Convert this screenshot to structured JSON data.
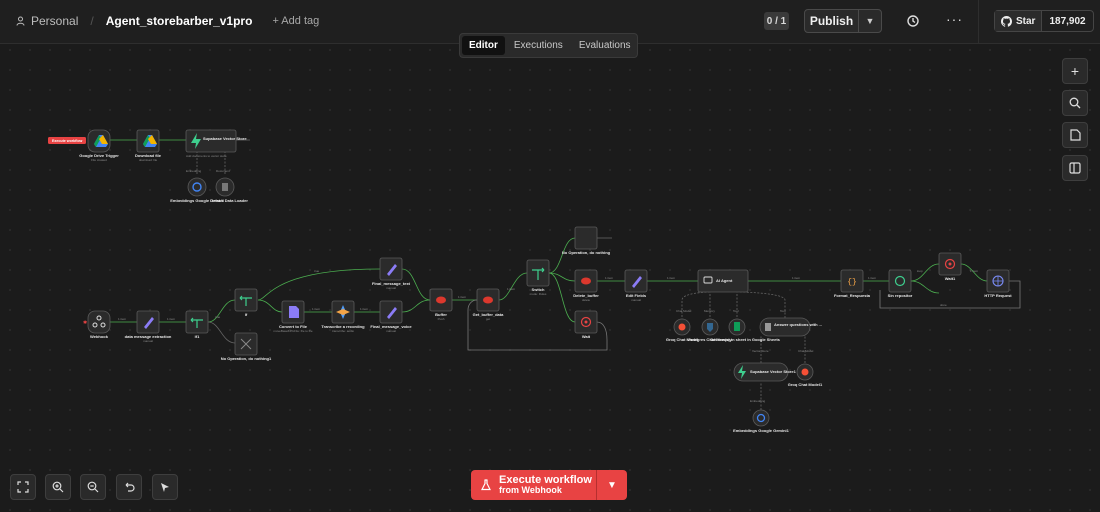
{
  "header": {
    "workspace": "Personal",
    "workflow_name": "Agent_storebarber_v1pro",
    "add_tag": "+ Add tag",
    "counter": "0 / 1",
    "publish": "Publish",
    "github_star": "Star",
    "github_count": "187,902"
  },
  "tabs": [
    {
      "label": "Editor",
      "active": true
    },
    {
      "label": "Executions",
      "active": false
    },
    {
      "label": "Evaluations",
      "active": false
    }
  ],
  "execute": {
    "line1": "Execute workflow",
    "line2": "from Webhook"
  },
  "colors": {
    "accent": "#e84343",
    "edge": "#4caf50",
    "node_bg": "#2b2b2b"
  },
  "right_tools": [
    "plus-icon",
    "search-icon",
    "sticky-note-icon",
    "panel-icon"
  ],
  "bottom_tools": [
    "fit-view-icon",
    "zoom-in-icon",
    "zoom-out-icon",
    "undo-icon",
    "tidy-up-icon"
  ],
  "trigger_badge": "Execute workflow",
  "nodes": {
    "gdrive_trigger": {
      "label": "Google Drive Trigger",
      "sub": "File created"
    },
    "download_file": {
      "label": "Download file",
      "sub": "download: file"
    },
    "supabase_store_top": {
      "label": "Supabase Vector Store",
      "sub": "Add documents to vector store"
    },
    "embeddings_top": {
      "label": "Embeddings Google Gemini"
    },
    "data_loader": {
      "label": "Default Data Loader"
    },
    "webhook": {
      "label": "Webhook"
    },
    "data_msg": {
      "label": "data message extraction",
      "sub": "manual"
    },
    "if1": {
      "label": "If1"
    },
    "if": {
      "label": "If"
    },
    "no_op1": {
      "label": "No Operation, do nothing1"
    },
    "convert_file": {
      "label": "Convert to File",
      "sub": "moveBase64ToFile: file to file"
    },
    "transcribe": {
      "label": "Transcribe a recording",
      "sub": "transcribe: audio"
    },
    "final_msg_text": {
      "label": "Final_message_text",
      "sub": "manual"
    },
    "final_msg_voice": {
      "label": "Final_message_voice",
      "sub": "manual"
    },
    "buffer": {
      "label": "Buffer",
      "sub": "Push"
    },
    "get_buffer": {
      "label": "Get_buffer_data",
      "sub": "get"
    },
    "switch": {
      "label": "Switch",
      "sub": "mode: Rules"
    },
    "no_op": {
      "label": "No Operation, do nothing"
    },
    "delete_buffer": {
      "label": "Delete_buffer",
      "sub": "delete"
    },
    "wait": {
      "label": "Wait"
    },
    "edit_fields": {
      "label": "Edit Fields",
      "sub": "manual"
    },
    "ai_agent": {
      "label": "AI Agent"
    },
    "groq1": {
      "label": "Groq Chat Model"
    },
    "postgres": {
      "label": "Postgres Chat Memory"
    },
    "sheets": {
      "label": "Get row(s) in sheet in Google Sheets"
    },
    "answer_tool": {
      "label": "Answer questions with ..."
    },
    "supabase_store_bottom": {
      "label": "Supabase Vector Store1"
    },
    "groq2": {
      "label": "Groq Chat Model1"
    },
    "embeddings_bottom": {
      "label": "Embeddings Google Gemini1"
    },
    "format_output": {
      "label": "Format_Respuesta"
    },
    "loop": {
      "label": "Sin repositor"
    },
    "wait1": {
      "label": "Wait1"
    },
    "http": {
      "label": "HTTP Request"
    }
  },
  "edge_labels": {
    "item": "1 item",
    "items": "1 item",
    "true": "true",
    "false": "false",
    "loop": "loop",
    "done": "done",
    "model": "Chat Model",
    "memory": "Memory",
    "tool": "Tool",
    "embedding": "Embedding",
    "document": "Document",
    "vector": "Vector Store"
  }
}
